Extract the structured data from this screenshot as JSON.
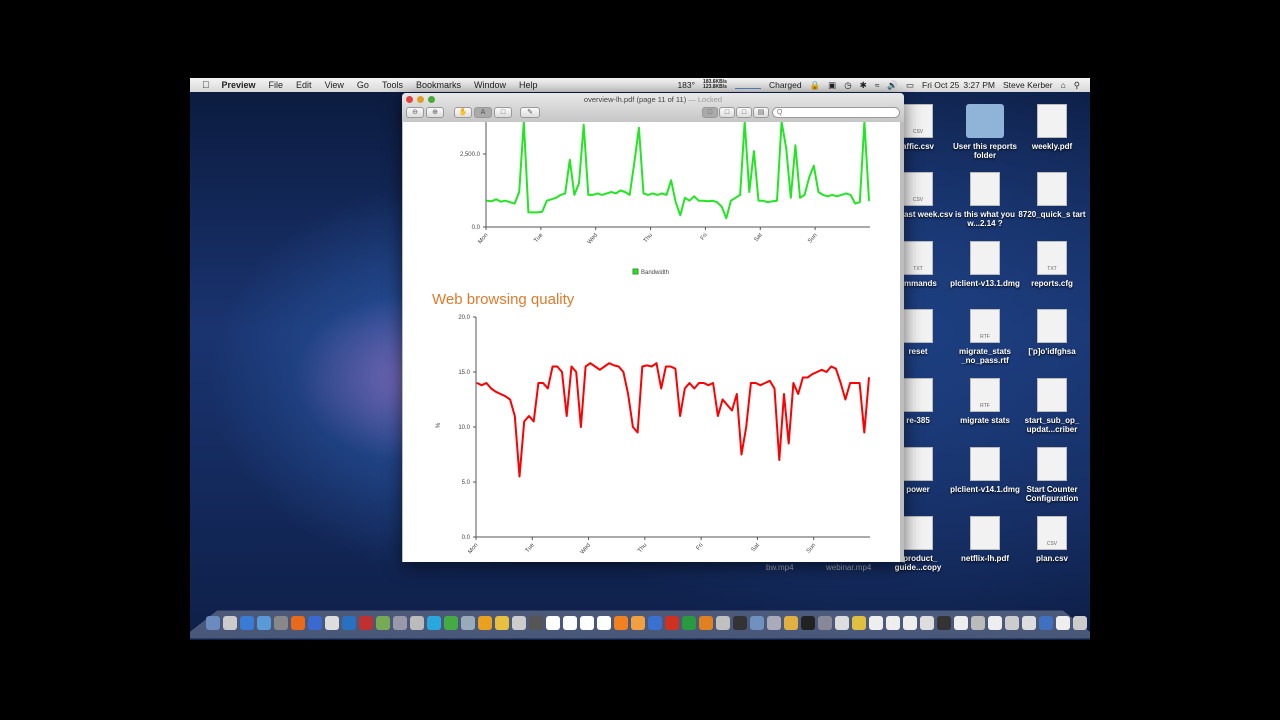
{
  "menubar": {
    "app": "Preview",
    "items": [
      "File",
      "Edit",
      "View",
      "Go",
      "Tools",
      "Bookmarks",
      "Window",
      "Help"
    ],
    "temp": "183°",
    "net_up": "183.6KB/s",
    "net_down": "123.8KB/s",
    "battery": "Charged",
    "date": "Fri Oct 25",
    "time": "3:27 PM",
    "user": "Steve Kerber"
  },
  "window": {
    "title": "overview-lh.pdf (page 11 of 11)",
    "locked": "— Locked",
    "search_placeholder": "Q"
  },
  "chart_data": [
    {
      "type": "line",
      "title": "",
      "xlabel": "",
      "ylabel": "",
      "yticks": [
        "0.0",
        "2,500.0"
      ],
      "ylim": [
        0,
        3550
      ],
      "categories": [
        "Mon",
        "Tue",
        "Wed",
        "Thu",
        "Fri",
        "Sat",
        "Sun"
      ],
      "legend": "Bandwidth",
      "legend_position": "bottom",
      "color": "#22e622",
      "values": [
        900,
        880,
        950,
        870,
        900,
        850,
        800,
        1200,
        3600,
        500,
        500,
        500,
        520,
        900,
        950,
        1000,
        1100,
        1150,
        2300,
        1100,
        1500,
        3500,
        1100,
        1100,
        1150,
        1100,
        1150,
        1200,
        1150,
        1250,
        1200,
        1100,
        2200,
        3400,
        1150,
        1100,
        1150,
        1100,
        1150,
        1100,
        1600,
        850,
        400,
        1000,
        900,
        1050,
        900,
        900,
        880,
        900,
        850,
        700,
        300,
        900,
        1000,
        1100,
        3600,
        1200,
        2600,
        900,
        900,
        850,
        880,
        900,
        3600,
        2700,
        1000,
        2800,
        1000,
        1100,
        1700,
        2100,
        1200,
        1100,
        1050,
        1100,
        1050,
        1100,
        1150,
        1100,
        800,
        850,
        3600,
        900
      ]
    },
    {
      "type": "line",
      "title": "Web browsing quality",
      "xlabel": "",
      "ylabel": "%",
      "yticks": [
        "0.0",
        "5.0",
        "10.0",
        "15.0",
        "20.0"
      ],
      "ylim": [
        0,
        20
      ],
      "categories": [
        "Mon",
        "Tue",
        "Wed",
        "Thu",
        "Fri",
        "Sat",
        "Sun"
      ],
      "color": "#ff0000",
      "values": [
        14,
        13.8,
        14,
        13.5,
        13.2,
        13,
        12.8,
        12.5,
        11,
        5.5,
        10.5,
        11,
        10.5,
        14,
        14,
        13.5,
        15.5,
        15.5,
        15,
        11,
        15.5,
        15,
        10,
        15.5,
        15.8,
        15.5,
        15.2,
        15.5,
        15.8,
        15.6,
        15.5,
        15,
        13,
        10,
        9.5,
        15.5,
        15.6,
        15.5,
        15.8,
        13.5,
        15.5,
        15.5,
        15.3,
        11,
        13.5,
        14,
        13.5,
        14,
        14,
        13.8,
        14,
        11,
        12.5,
        12,
        11.5,
        13,
        7.5,
        10,
        14,
        14,
        13.8,
        14,
        14.2,
        13.5,
        7,
        13,
        8.5,
        14,
        13,
        14.5,
        14.5,
        14.8,
        15,
        15.2,
        15,
        15.5,
        15.3,
        14,
        12.5,
        14,
        14,
        14,
        9.5,
        14.5
      ]
    }
  ],
  "desktop": {
    "col_left": [
      "affic.csv",
      "affic last week.csv",
      "ommands",
      "reset",
      "re-385",
      "power",
      "_product_ guide...copy"
    ],
    "col_mid": [
      "User this reports folder",
      "is this what you w...2.14 ?",
      "plclient-v13.1.dmg",
      "migrate_stats _no_pass.rtf",
      "migrate stats",
      "plclient-v14.1.dmg",
      "netflix-lh.pdf"
    ],
    "col_right": [
      "weekly.pdf",
      "8720_quick_s tart",
      "reports.cfg",
      "['p]o'idfghsa",
      "start_sub_op_ updat...criber",
      "Start Counter Configuration",
      "plan.csv"
    ],
    "badges_left": [
      "CSV",
      "CSV",
      "TXT",
      "",
      "",
      "",
      ""
    ],
    "badges_mid": [
      "",
      "",
      "",
      "RTF",
      "RTF",
      "",
      ""
    ],
    "badges_right": [
      "",
      "",
      "TXT",
      "",
      "",
      "",
      "CSV"
    ],
    "videos": [
      "bw.mp4",
      "webinar.mp4"
    ]
  },
  "dock_colors": [
    "#6a8ac0",
    "#ccc",
    "#3a7bd5",
    "#5a9ad8",
    "#888",
    "#e86a1a",
    "#3a6ad0",
    "#ddd",
    "#2a70c0",
    "#c03030",
    "#7a5",
    "#99a",
    "#bbb",
    "#29a8e0",
    "#4a4",
    "#9ab",
    "#e8a020",
    "#e8c040",
    "#ccc",
    "#555",
    "#fff",
    "#fff",
    "#fff",
    "#fff",
    "#f08020",
    "#f0a040",
    "#3a70d0",
    "#d03020",
    "#2a9a40",
    "#e08020",
    "#c0c0c0",
    "#333",
    "#7090c0",
    "#aab",
    "#e0b040",
    "#222",
    "#889",
    "#ddd",
    "#e0c040",
    "#eee",
    "#eee",
    "#eee",
    "#ddd",
    "#333",
    "#eee",
    "#bbb",
    "#eee",
    "#ccc",
    "#ddd",
    "#4070c0",
    "#eee",
    "#ccc"
  ]
}
